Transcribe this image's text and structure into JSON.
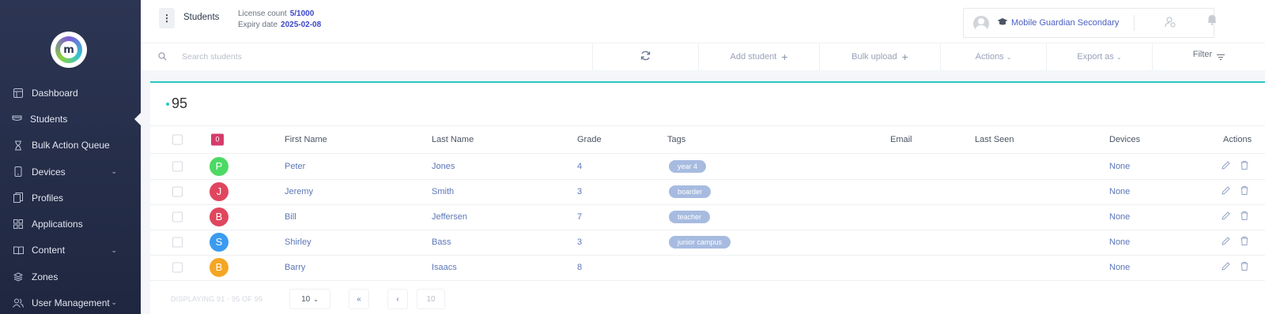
{
  "sidebar": {
    "items": [
      {
        "label": "Dashboard",
        "icon": "dashboard-icon"
      },
      {
        "label": "Students",
        "icon": "students-icon",
        "active": true
      },
      {
        "label": "Bulk Action Queue",
        "icon": "hourglass-icon"
      },
      {
        "label": "Devices",
        "icon": "device-icon",
        "expandable": true
      },
      {
        "label": "Profiles",
        "icon": "profiles-icon"
      },
      {
        "label": "Applications",
        "icon": "apps-grid-icon"
      },
      {
        "label": "Content",
        "icon": "book-icon",
        "expandable": true
      },
      {
        "label": "Zones",
        "icon": "zones-icon"
      },
      {
        "label": "User Management",
        "icon": "users-icon",
        "expandable": true
      }
    ]
  },
  "header": {
    "page_name": "Students",
    "license_label": "License count",
    "license_value": "5/1000",
    "expiry_label": "Expiry date",
    "expiry_value": "2025-02-08",
    "school_name": "Mobile Guardian Secondary"
  },
  "toolbar": {
    "search_placeholder": "Search students",
    "add_student": "Add student",
    "bulk_upload": "Bulk upload",
    "actions": "Actions",
    "export_as": "Export as",
    "filter": "Filter"
  },
  "summary": {
    "count": "95"
  },
  "table": {
    "selected_count": "0",
    "headers": {
      "first_name": "First Name",
      "last_name": "Last Name",
      "grade": "Grade",
      "tags": "Tags",
      "email": "Email",
      "last_seen": "Last Seen",
      "devices": "Devices",
      "actions": "Actions"
    },
    "rows": [
      {
        "initial": "P",
        "color": "#4cd964",
        "first": "Peter",
        "last": "Jones",
        "grade": "4",
        "tag": "year 4",
        "devices": "None"
      },
      {
        "initial": "J",
        "color": "#e0465e",
        "first": "Jeremy",
        "last": "Smith",
        "grade": "3",
        "tag": "boarder",
        "devices": "None"
      },
      {
        "initial": "B",
        "color": "#e0465e",
        "first": "Bill",
        "last": "Jeffersen",
        "grade": "7",
        "tag": "teacher",
        "devices": "None"
      },
      {
        "initial": "S",
        "color": "#3b9bf0",
        "first": "Shirley",
        "last": "Bass",
        "grade": "3",
        "tag": "junior campus",
        "devices": "None"
      },
      {
        "initial": "B",
        "color": "#f5a623",
        "first": "Barry",
        "last": "Isaacs",
        "grade": "8",
        "tag": "",
        "devices": "None"
      }
    ]
  },
  "pagination": {
    "displaying": "DISPLAYING 91 - 95 OF 95",
    "page_size": "10",
    "page": "10"
  },
  "colors": {
    "accent": "#2cc7c2",
    "sidebar": "#2c3553",
    "link": "#5b76b7",
    "badge": "#d63b6b"
  }
}
